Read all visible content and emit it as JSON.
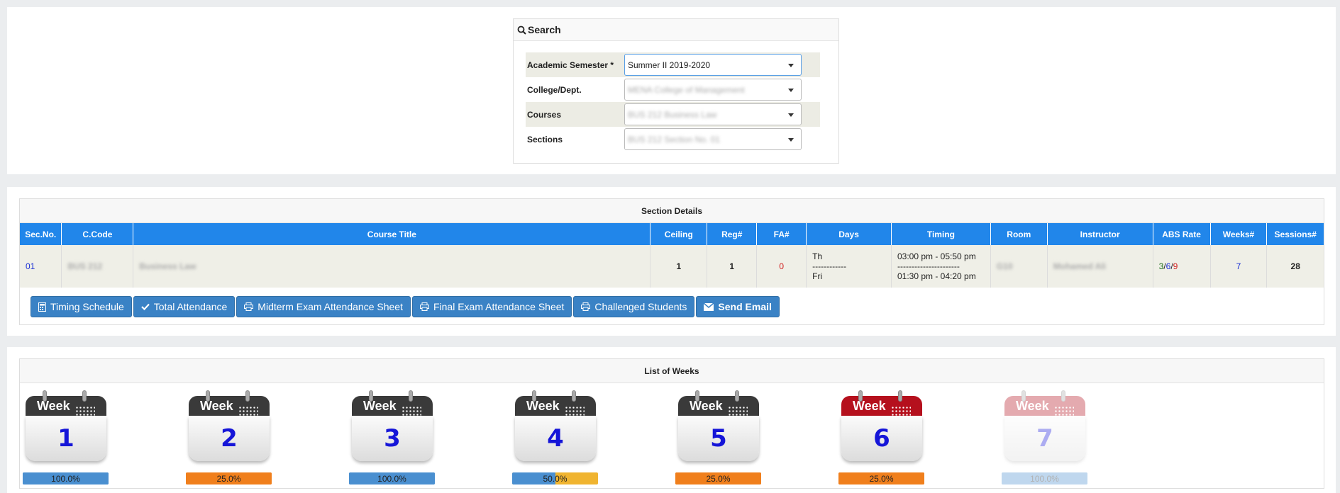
{
  "search": {
    "title": "Search",
    "fields": [
      {
        "label": "Academic Semester",
        "required_mark": "*",
        "value": "Summer II 2019-2020"
      },
      {
        "label": "College/Dept.",
        "value": "MENA College of Management"
      },
      {
        "label": "Courses",
        "value": "BUS 212 Business Law"
      },
      {
        "label": "Sections",
        "value": "BUS 212 Section No. 01"
      }
    ]
  },
  "section_details": {
    "title": "Section Details",
    "headers": [
      "Sec.No.",
      "C.Code",
      "Course Title",
      "Ceiling",
      "Reg#",
      "FA#",
      "Days",
      "Timing",
      "Room",
      "Instructor",
      "ABS Rate",
      "Weeks#",
      "Sessions#"
    ],
    "row": {
      "sec_no": "01",
      "c_code": "BUS 212",
      "course_title": "Business Law",
      "ceiling": "1",
      "reg": "1",
      "fa": "0",
      "day1": "Th",
      "day_sep": "------------",
      "day2": "Fri",
      "time1": "03:00 pm - 05:50 pm",
      "time_sep": "----------------------",
      "time2": "01:30 pm - 04:20 pm",
      "room": "G10",
      "instructor": "Mohamed Ali",
      "abs_a": "3",
      "abs_b": "6",
      "abs_c": "9",
      "abs_sep": "/",
      "weeks": "7",
      "sessions": "28"
    },
    "buttons": {
      "timing": "Timing Schedule",
      "total": "Total Attendance",
      "midterm": "Midterm Exam Attendance Sheet",
      "final": "Final Exam Attendance Sheet",
      "challenged": "Challenged Students",
      "email": "Send Email"
    }
  },
  "weeks": {
    "title": "List of Weeks",
    "label": "Week",
    "items": [
      {
        "num": "1",
        "pct": "100.0%",
        "fill": 1.0,
        "header": "#3a3a3a",
        "bar": "#4a8fd0",
        "rest": "#4a8fd0"
      },
      {
        "num": "2",
        "pct": "25.0%",
        "fill": 1.0,
        "header": "#3a3a3a",
        "bar": "#f07f1c",
        "rest": "#f07f1c"
      },
      {
        "num": "3",
        "pct": "100.0%",
        "fill": 1.0,
        "header": "#3a3a3a",
        "bar": "#4a8fd0",
        "rest": "#4a8fd0"
      },
      {
        "num": "4",
        "pct": "50.0%",
        "fill": 0.5,
        "header": "#3a3a3a",
        "bar": "#4a8fd0",
        "rest": "#f0b430"
      },
      {
        "num": "5",
        "pct": "25.0%",
        "fill": 1.0,
        "header": "#3a3a3a",
        "bar": "#f07f1c",
        "rest": "#f07f1c"
      },
      {
        "num": "6",
        "pct": "25.0%",
        "fill": 1.0,
        "header": "#b5101d",
        "bar": "#f07f1c",
        "rest": "#f07f1c"
      },
      {
        "num": "7",
        "pct": "100.0%",
        "fill": 1.0,
        "header": "#b5101d",
        "bar": "#4a8fd0",
        "rest": "#4a8fd0",
        "faded": true
      }
    ]
  }
}
